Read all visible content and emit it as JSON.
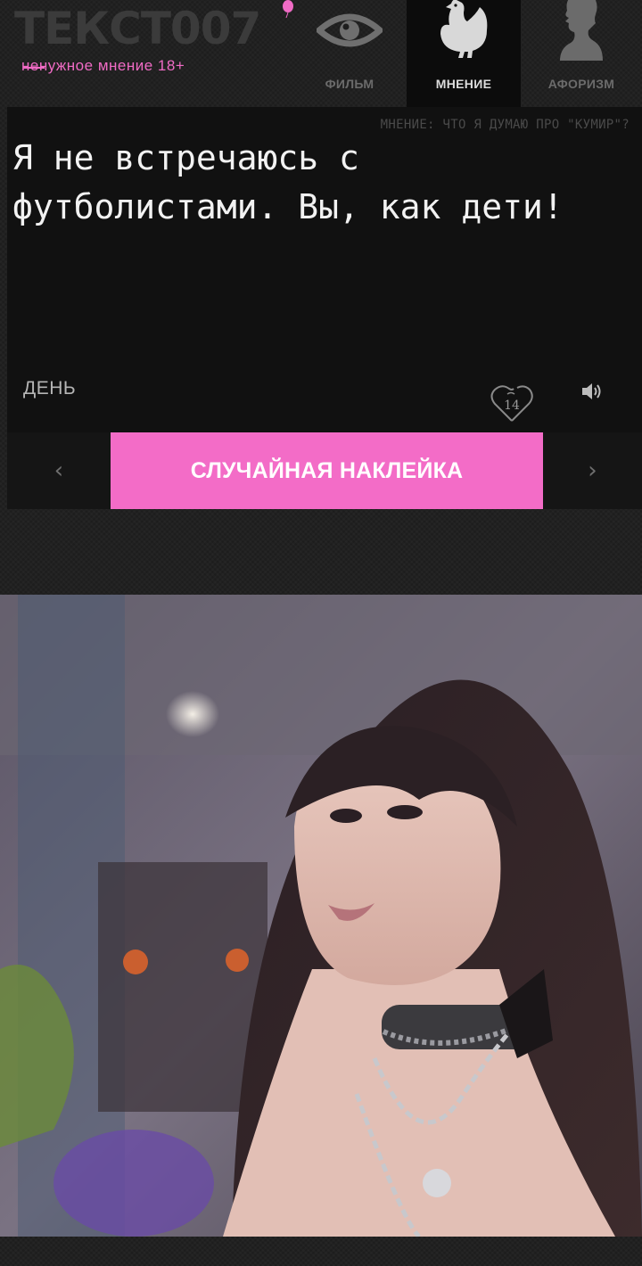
{
  "header": {
    "logo_title": "ТЕКСТ007",
    "logo_subtitle": "ненужное мнение 18+",
    "tabs": [
      {
        "label": "ФИЛЬМ",
        "icon": "eye-icon"
      },
      {
        "label": "МНЕНИЕ",
        "icon": "chicken-icon",
        "active": true
      },
      {
        "label": "АФОРИЗМ",
        "icon": "silhouette-profile-icon"
      }
    ]
  },
  "card": {
    "caption": "МНЕНИЕ: ЧТО Я ДУМАЮ ПРО \"КУМИР\"?",
    "quote": "Я не встречаюсь с футболистами. Вы, как дети!",
    "day_label": "ДЕНЬ",
    "like_count": "14",
    "sound_icon": "speaker-icon"
  },
  "sticker_bar": {
    "prev_icon": "chevron-left-icon",
    "next_icon": "chevron-right-icon",
    "random_label": "СЛУЧАЙНАЯ НАКЛЕЙКА"
  },
  "colors": {
    "accent": "#f36cc7",
    "background": "#1d1d1d",
    "card": "#111111"
  }
}
